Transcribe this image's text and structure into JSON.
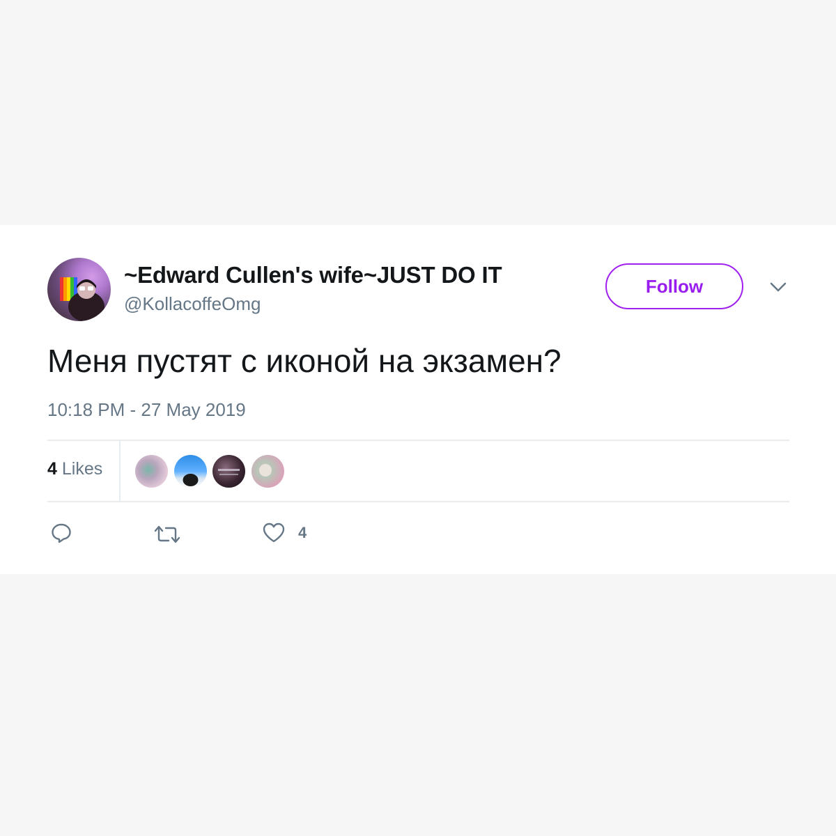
{
  "tweet": {
    "author": {
      "display_name": "~Edward Cullen's wife~JUST DO IT",
      "username": "@KollacoffeOmg",
      "avatar_icon": "profile-photo"
    },
    "follow_label": "Follow",
    "text": "Меня пустят с иконой на экзамен?",
    "timestamp": "10:18 PM - 27 May 2019",
    "likes": {
      "count": "4",
      "label": "Likes",
      "liker_avatars": [
        "liker-avatar-1",
        "liker-avatar-2",
        "liker-avatar-3",
        "liker-avatar-4"
      ]
    },
    "actions": {
      "reply_icon": "reply-icon",
      "retweet_icon": "retweet-icon",
      "like_icon": "heart-icon",
      "like_count": "4"
    }
  },
  "colors": {
    "accent": "#a020f0",
    "text_primary": "#14171a",
    "text_secondary": "#657786",
    "divider": "#e6ecf0",
    "page_background": "#f6f6f6",
    "card_background": "#ffffff"
  }
}
